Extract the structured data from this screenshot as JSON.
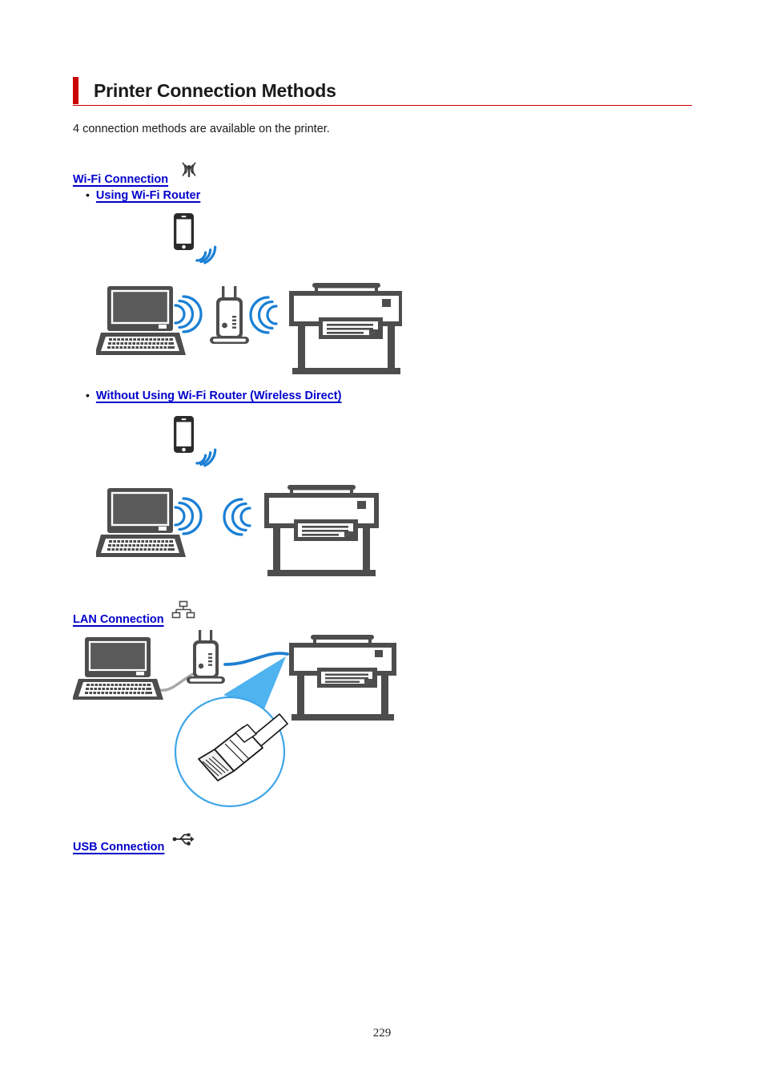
{
  "document": {
    "title": "Printer Connection Methods",
    "intro": "4 connection methods are available on the printer.",
    "page_number": "229",
    "accent_color": "#cc0000",
    "link_color": "#0000cc",
    "wifi_wave_color": "#1a7fd4",
    "device_color": "#4d4d4d",
    "lan_cable_color": "#1f7fd0",
    "magnifier_color": "#3ea6e8"
  },
  "sections": [
    {
      "id": "wifi",
      "heading": "Wi-Fi Connection",
      "icon": "wifi-antenna-icon",
      "bullets": [
        {
          "id": "using-wifi-router",
          "label": "Using Wi-Fi Router",
          "figure": {
            "name": "wifi-router-connection-diagram",
            "devices": [
              "smartphone",
              "laptop",
              "wifi-router",
              "large-format-printer"
            ],
            "signals": [
              "smartphone-to-router",
              "laptop-to-router",
              "router-to-printer"
            ]
          }
        },
        {
          "id": "wireless-direct",
          "label": "Without Using Wi-Fi Router (Wireless Direct)",
          "figure": {
            "name": "wireless-direct-connection-diagram",
            "devices": [
              "smartphone",
              "laptop",
              "large-format-printer"
            ],
            "signals": [
              "smartphone-to-printer",
              "laptop-to-printer"
            ]
          }
        }
      ]
    },
    {
      "id": "lan",
      "heading": "LAN Connection",
      "icon": "lan-network-icon",
      "figure": {
        "name": "lan-connection-diagram",
        "devices": [
          "laptop",
          "wifi-router",
          "large-format-printer"
        ],
        "cables": [
          "laptop-to-router-grey-cable",
          "router-to-printer-blue-cable"
        ],
        "callout": "rj45-connector-magnifier"
      }
    },
    {
      "id": "usb",
      "heading": "USB Connection",
      "icon": "usb-trident-icon"
    }
  ]
}
